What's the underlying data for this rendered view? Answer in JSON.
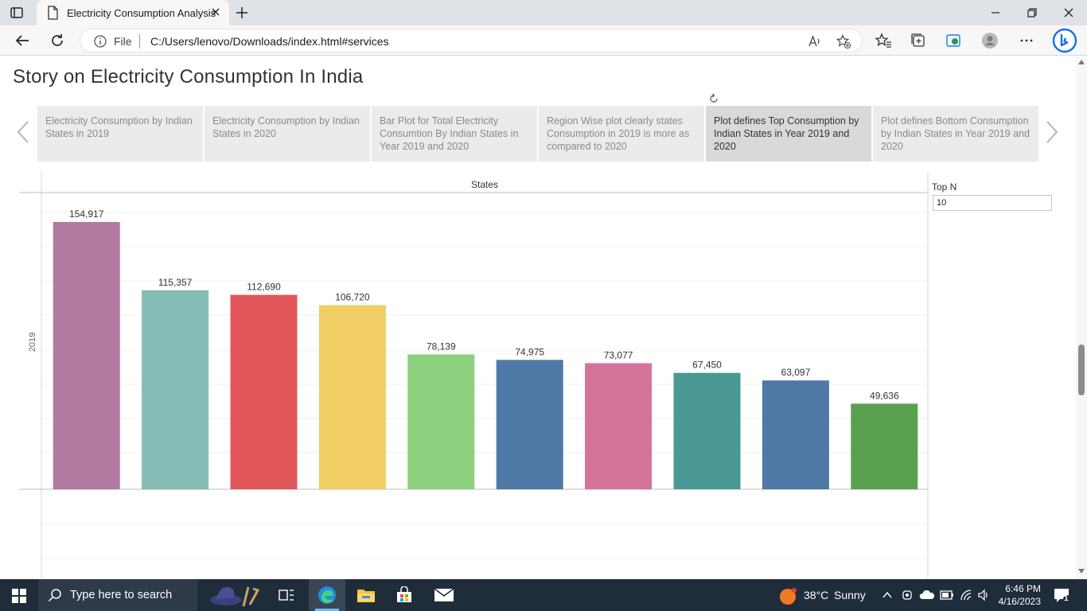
{
  "browser": {
    "tab_title": "Electricity Consumption Analysis",
    "omnibox_scheme": "File",
    "url": "C:/Users/lenovo/Downloads/index.html#services"
  },
  "story": {
    "title": "Story on Electricity Consumption In India",
    "points": [
      {
        "label": "Electricity Consumption by Indian States in 2019",
        "active": false
      },
      {
        "label": "Electricity Consumption by Indian States in 2020",
        "active": false
      },
      {
        "label": "Bar Plot for Total Electricity Consumtion By Indian States in Year 2019 and 2020",
        "active": false
      },
      {
        "label": "Region Wise plot clearly states Consumption in 2019 is more as compared to 2020",
        "active": false
      },
      {
        "label": "Plot defines Top Consumption by Indian States in Year 2019 and 2020",
        "active": true
      },
      {
        "label": "Plot defines Bottom Consumption by Indian States in Year 2019 and 2020",
        "active": false
      }
    ]
  },
  "parameter": {
    "label": "Top N",
    "value": "10"
  },
  "chart_data": {
    "type": "bar",
    "xlabel": "States",
    "ylabel": "2019",
    "values": [
      154917,
      115357,
      112690,
      106720,
      78139,
      74975,
      73077,
      67450,
      63097,
      49636
    ],
    "data_labels": [
      "154,917",
      "115,357",
      "112,690",
      "106,720",
      "78,139",
      "74,975",
      "73,077",
      "67,450",
      "63,097",
      "49,636"
    ],
    "colors": [
      "#b07aa1",
      "#86bcb6",
      "#e15759",
      "#f1ce63",
      "#8cd17d",
      "#4e79a7",
      "#d4749a",
      "#499894",
      "#4e79a7",
      "#59a14f"
    ],
    "ylim": [
      0,
      172000
    ],
    "grid": true
  },
  "taskbar": {
    "search_placeholder": "Type here to search",
    "weather_temp": "38°C",
    "weather_text": "Sunny",
    "time": "6:46 PM",
    "date": "4/16/2023",
    "notification_count": "1"
  },
  "colors": {
    "titlebar": "#dfe3e8",
    "taskbar": "#1f2c3a",
    "active_story_point": "#d9d9d9"
  }
}
